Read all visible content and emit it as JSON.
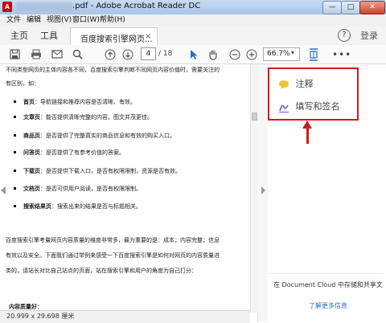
{
  "window": {
    "title": "Adobe Acrobat Reader DC",
    "file_suffix": ".pdf",
    "min_glyph": "—",
    "max_glyph": "□",
    "close_glyph": "✕"
  },
  "menu": [
    "文件",
    "编辑",
    "视图(V)",
    "窗口(W)",
    "帮助(H)"
  ],
  "nav": {
    "home": "主页",
    "tools": "工具",
    "login": "登录",
    "help": "?"
  },
  "doc_tab": {
    "label": "百度搜索引擎网页...",
    "close": "×"
  },
  "toolbar": {
    "page_current": "4",
    "page_total": "/ 18",
    "zoom": "66.7%",
    "zoom_caret": "▾",
    "more": "•••"
  },
  "document": {
    "lines": [
      "不同类型网页的主体内容各不同，百度搜索引擎判断不同网页内容价值时，需要关注的",
      "有区别，如：",
      "首页：导航链接和推荐内容是否清晰、有效。",
      "文章页：能否提供清晰完整的内容，图文并茂更佳。",
      "商品页：是否提供了完整真实的商品信息和有效的购买入口。",
      "问答页：是否提供了有参考价值的答案。",
      "下载页：是否提供下载入口，是否有权限限制，资源是否有效。",
      "文档页：是否可供用户阅读，是否有权限限制。",
      "搜索结果页：搜索出来的结果是否与标题相关。",
      "百度搜索引擎考量网页内容质量的维度非常多，最为重要的是：成本；内容完整；信息",
      "有效以及安全。下面我们通过举例来感受一下百度搜索引擎是如何对网页的内容质量进",
      "类的，请站长对比自己站点的页面，站在搜索引擎和用户的角度为自己打分：",
      "内容质量好："
    ],
    "bold_prefixes": [
      "首页",
      "文章页",
      "商品页",
      "问答页",
      "下载页",
      "文档页",
      "搜索结果页"
    ],
    "status": "20.999 x 29.698 厘米"
  },
  "right_pane": {
    "comment": "注释",
    "fill_sign": "填写和签名",
    "promo_line": "在 Document Cloud 中存储和共享文",
    "promo_link": "了解更多信息"
  },
  "colors": {
    "highlight": "#d21b1b",
    "accent": "#2a6fc9",
    "comment_icon": "#f0c230",
    "sign_icon": "#6a5bc7"
  }
}
